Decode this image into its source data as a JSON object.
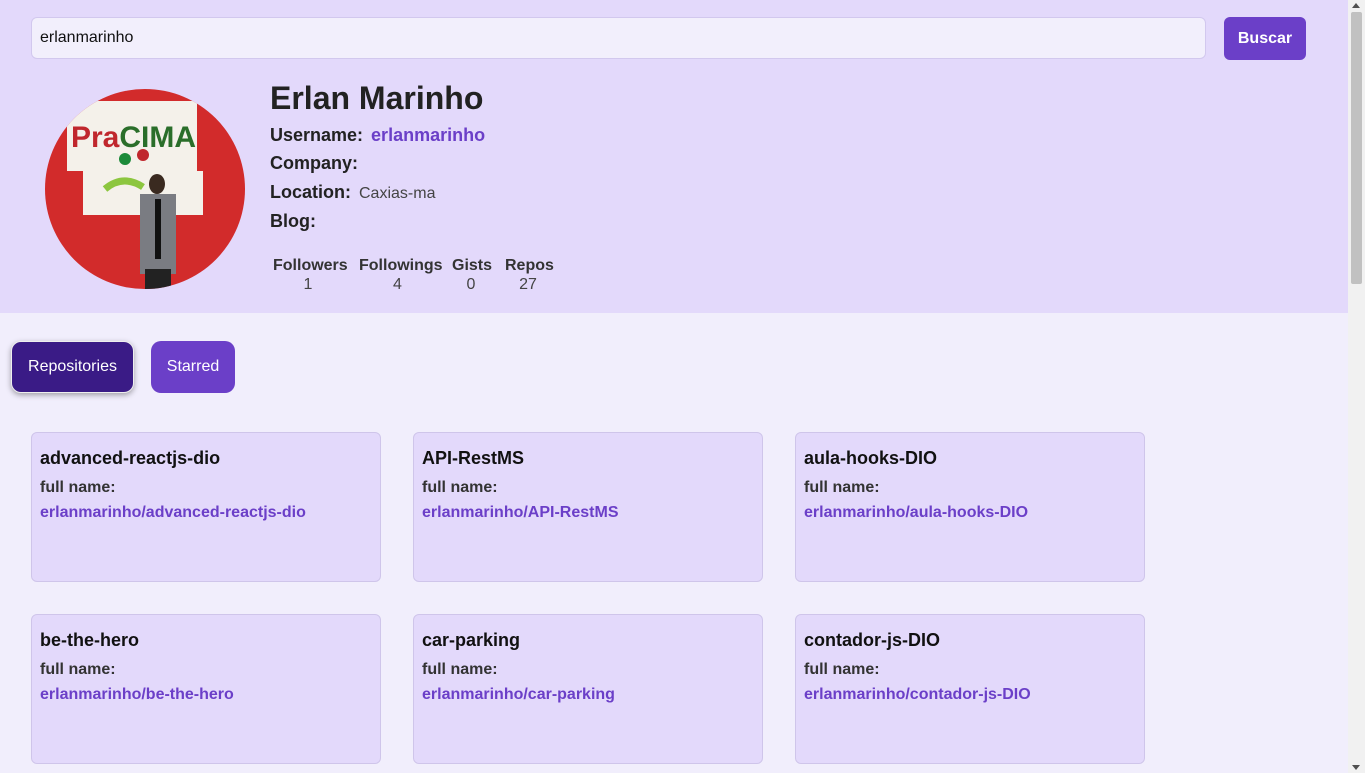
{
  "search": {
    "value": "erlanmarinho",
    "button_label": "Buscar"
  },
  "profile": {
    "name": "Erlan Marinho",
    "username_label": "Username:",
    "username": "erlanmarinho",
    "company_label": "Company:",
    "company": "",
    "location_label": "Location:",
    "location": "Caxias-ma",
    "blog_label": "Blog:",
    "blog": "",
    "avatar_text": "PraCIMA"
  },
  "stats": [
    {
      "label": "Followers",
      "value": "1"
    },
    {
      "label": "Followings",
      "value": "4"
    },
    {
      "label": "Gists",
      "value": "0"
    },
    {
      "label": "Repos",
      "value": "27"
    }
  ],
  "tabs": [
    {
      "label": "Repositories",
      "active": true
    },
    {
      "label": "Starred",
      "active": false
    }
  ],
  "repos": [
    {
      "name": "advanced-reactjs-dio",
      "full_name_label": "full name:",
      "full_name": "erlanmarinho/advanced-reactjs-dio"
    },
    {
      "name": "API-RestMS",
      "full_name_label": "full name:",
      "full_name": "erlanmarinho/API-RestMS"
    },
    {
      "name": "aula-hooks-DIO",
      "full_name_label": "full name:",
      "full_name": "erlanmarinho/aula-hooks-DIO"
    },
    {
      "name": "be-the-hero",
      "full_name_label": "full name:",
      "full_name": "erlanmarinho/be-the-hero"
    },
    {
      "name": "car-parking",
      "full_name_label": "full name:",
      "full_name": "erlanmarinho/car-parking"
    },
    {
      "name": "contador-js-DIO",
      "full_name_label": "full name:",
      "full_name": "erlanmarinho/contador-js-DIO"
    }
  ],
  "colors": {
    "accent": "#6b3fc8",
    "accent_dark": "#3a1b86",
    "header_bg": "#e3d9fb",
    "page_bg": "#f1eefc"
  }
}
